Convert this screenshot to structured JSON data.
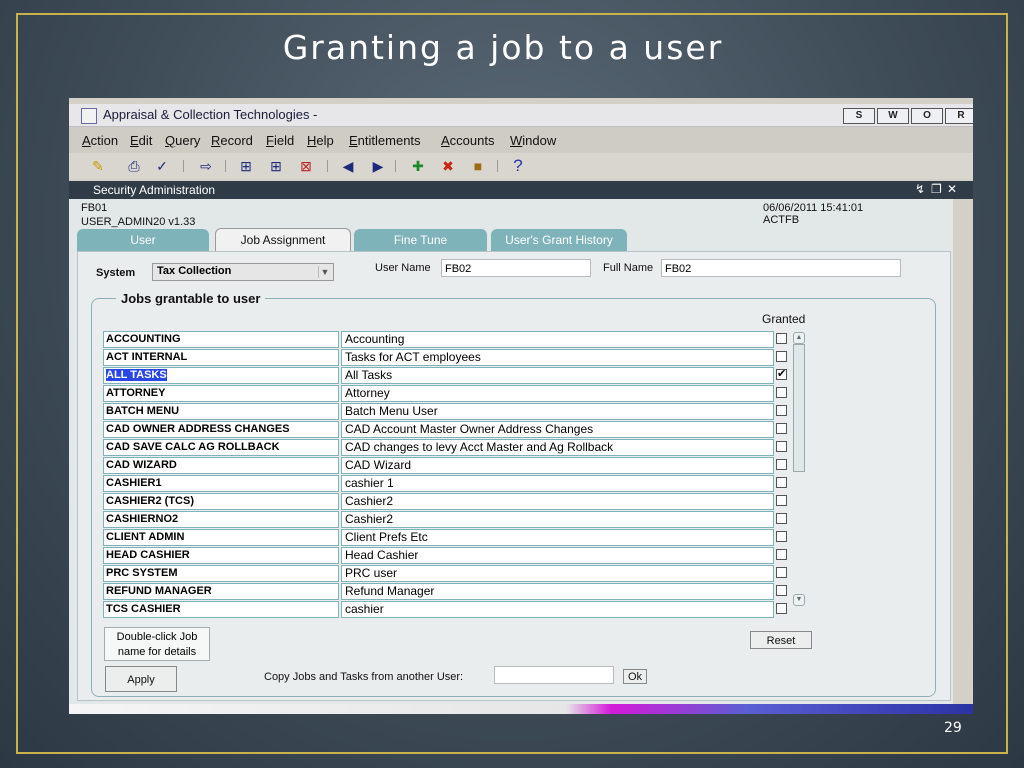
{
  "slide": {
    "title": "Granting a job to a user",
    "page_number": "29"
  },
  "app": {
    "title": "Appraisal & Collection Technologies -",
    "window_buttons": [
      "S",
      "W",
      "O",
      "R"
    ],
    "menu": [
      "Action",
      "Edit",
      "Query",
      "Record",
      "Field",
      "Help",
      "Entitlements",
      "Accounts",
      "Window"
    ],
    "toolbar_icons": [
      "folder-icon",
      "print-icon",
      "save-icon",
      "exit-icon",
      "query-icon",
      "query-execute-icon",
      "query-cancel-icon",
      "prev-icon",
      "next-icon",
      "insert-icon",
      "delete-icon",
      "lock-icon",
      "help-icon"
    ]
  },
  "form": {
    "title": "Security Administration",
    "form_code": "FB01",
    "module": "USER_ADMIN20 v1.33",
    "datetime": "06/06/2011 15:41:01",
    "user_code": "ACTFB",
    "tabs": [
      {
        "label": "User",
        "active": false
      },
      {
        "label": "Job Assignment",
        "active": true
      },
      {
        "label": "Fine Tune",
        "active": false
      },
      {
        "label": "User's Grant History",
        "active": false
      }
    ],
    "system_label": "System",
    "system_value": "Tax Collection",
    "user_name_label": "User Name",
    "user_name_value": "FB02",
    "full_name_label": "Full Name",
    "full_name_value": "FB02",
    "jobs_legend": "Jobs grantable to user",
    "granted_label": "Granted",
    "jobs": [
      {
        "name": "ACCOUNTING",
        "desc": "Accounting",
        "granted": false
      },
      {
        "name": "ACT INTERNAL",
        "desc": "Tasks for ACT employees",
        "granted": false
      },
      {
        "name": "ALL TASKS",
        "desc": "All Tasks",
        "granted": true
      },
      {
        "name": "ATTORNEY",
        "desc": "Attorney",
        "granted": false
      },
      {
        "name": "BATCH MENU",
        "desc": "Batch Menu User",
        "granted": false
      },
      {
        "name": "CAD OWNER ADDRESS CHANGES",
        "desc": "CAD Account Master Owner Address Changes",
        "granted": false
      },
      {
        "name": "CAD SAVE CALC AG ROLLBACK",
        "desc": "CAD changes to levy Acct Master and Ag Rollback",
        "granted": false
      },
      {
        "name": "CAD WIZARD",
        "desc": "CAD Wizard",
        "granted": false
      },
      {
        "name": "CASHIER1",
        "desc": "cashier 1",
        "granted": false
      },
      {
        "name": "CASHIER2 (TCS)",
        "desc": "Cashier2",
        "granted": false
      },
      {
        "name": "CASHIERNO2",
        "desc": "Cashier2",
        "granted": false
      },
      {
        "name": "CLIENT ADMIN",
        "desc": "Client Prefs Etc",
        "granted": false
      },
      {
        "name": "HEAD CASHIER",
        "desc": "Head Cashier",
        "granted": false
      },
      {
        "name": "PRC SYSTEM",
        "desc": "PRC user",
        "granted": false
      },
      {
        "name": "REFUND MANAGER",
        "desc": "Refund Manager",
        "granted": false
      },
      {
        "name": "TCS CASHIER",
        "desc": "cashier",
        "granted": false
      }
    ],
    "hint_text": "Double-click Job name for details",
    "reset_label": "Reset",
    "apply_label": "Apply",
    "copy_label": "Copy Jobs and Tasks from another User:",
    "copy_value": "",
    "ok_label": "Ok"
  },
  "colors": {
    "accent_tab": "#7fb3ba",
    "selection": "#2946e6",
    "frame": "#c9b24a"
  }
}
